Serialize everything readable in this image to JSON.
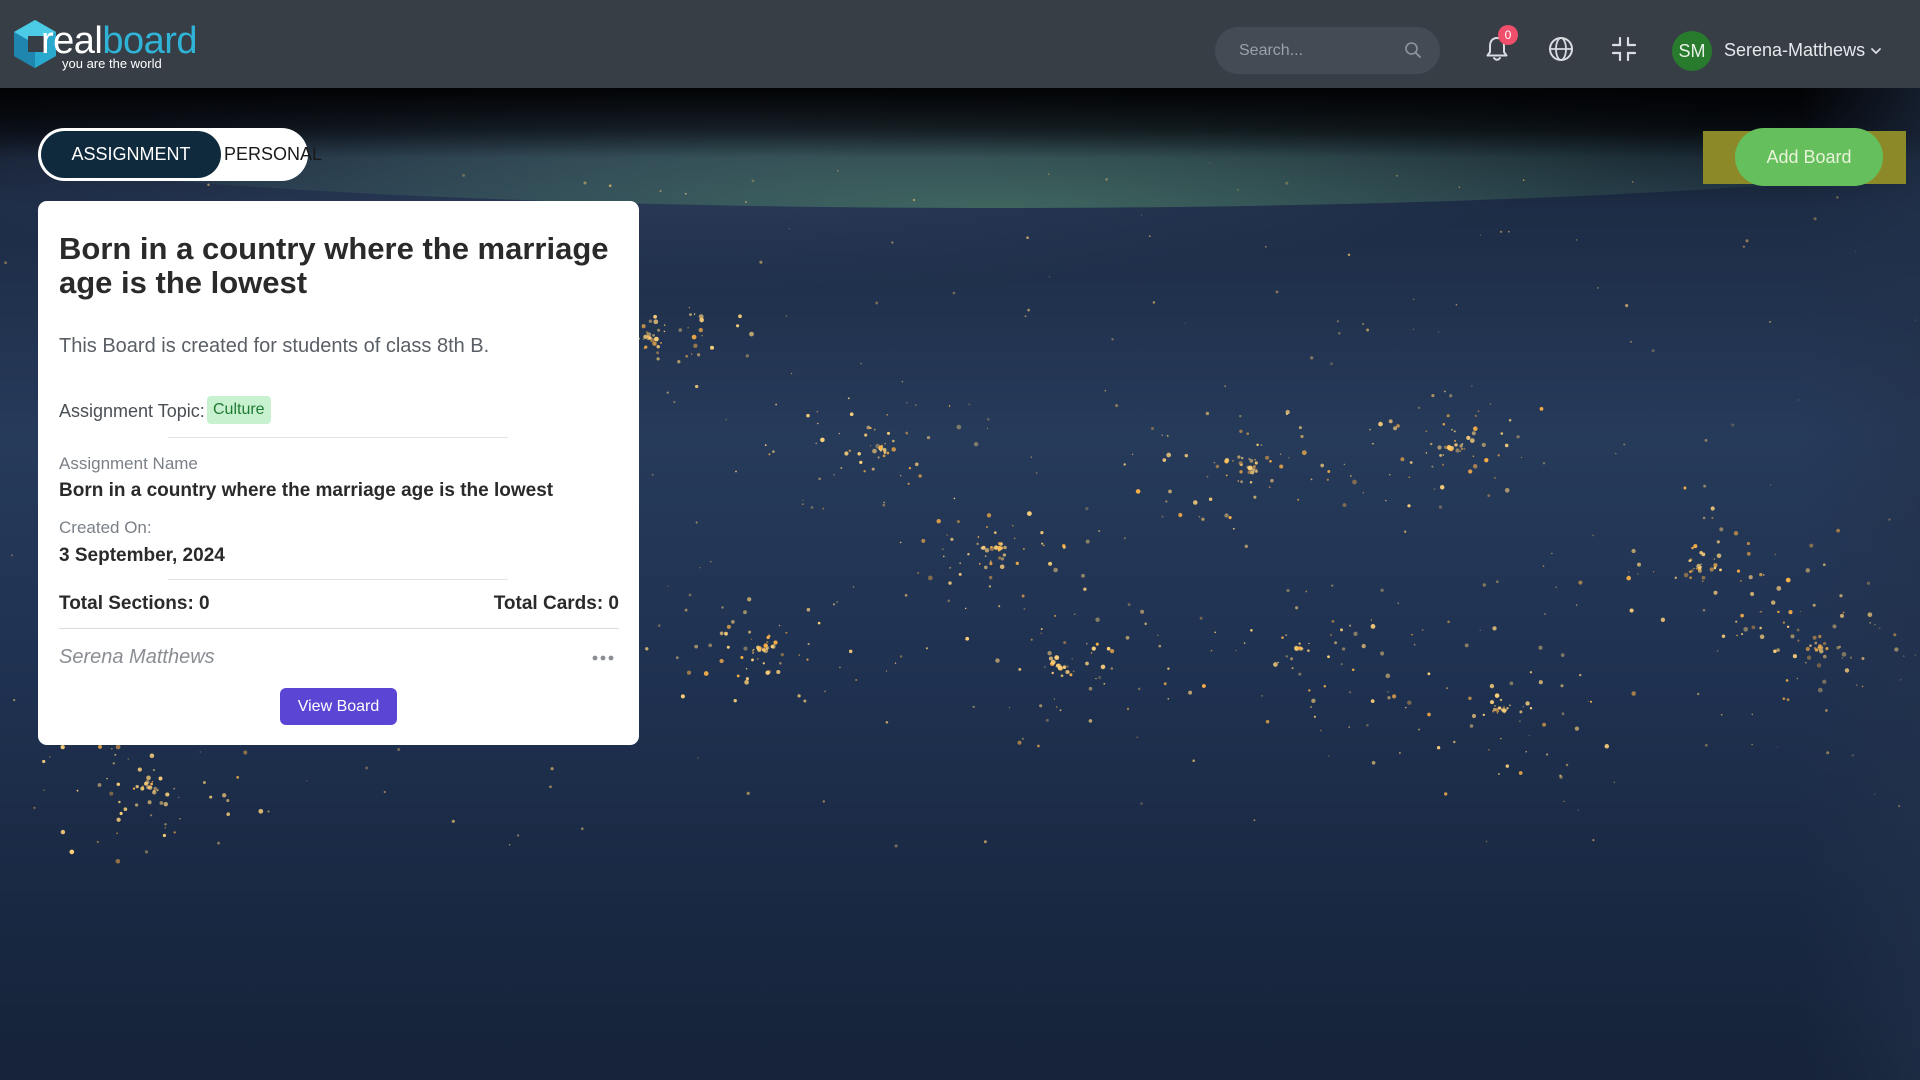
{
  "brand": {
    "name_part1": "real",
    "name_part2": "board",
    "tagline": "you are the world"
  },
  "header": {
    "search_placeholder": "Search...",
    "notification_count": "0",
    "user_initials": "SM",
    "user_name": "Serena-Matthews"
  },
  "tabs": {
    "assignment": "ASSIGNMENT",
    "personal": "PERSONAL",
    "active": "ASSIGNMENT"
  },
  "actions": {
    "add_board": "Add Board"
  },
  "board_card": {
    "title": "Born in a country where the marriage age is the lowest",
    "description": "This Board is created for students of class 8th B.",
    "topic_label": "Assignment Topic:",
    "topic": "Culture",
    "name_label": "Assignment Name",
    "name": "Born in a country where the marriage age is the lowest",
    "created_label": "Created On:",
    "created_on": "3 September, 2024",
    "total_sections": "Total Sections: 0",
    "total_cards": "Total Cards: 0",
    "author": "Serena Matthews",
    "view_button": "View Board"
  },
  "colors": {
    "topbar": "#373e46",
    "tab_active": "#0e2a3c",
    "add_button": "#64bf5c",
    "view_button": "#5a45d4",
    "badge": "#ef4f6a",
    "avatar": "#287a2d",
    "topic_pill": "#c8f2cf"
  },
  "icons": [
    "search-icon",
    "bell-icon",
    "globe-icon",
    "shrink-icon",
    "chevron-down-icon",
    "more-horizontal-icon"
  ]
}
